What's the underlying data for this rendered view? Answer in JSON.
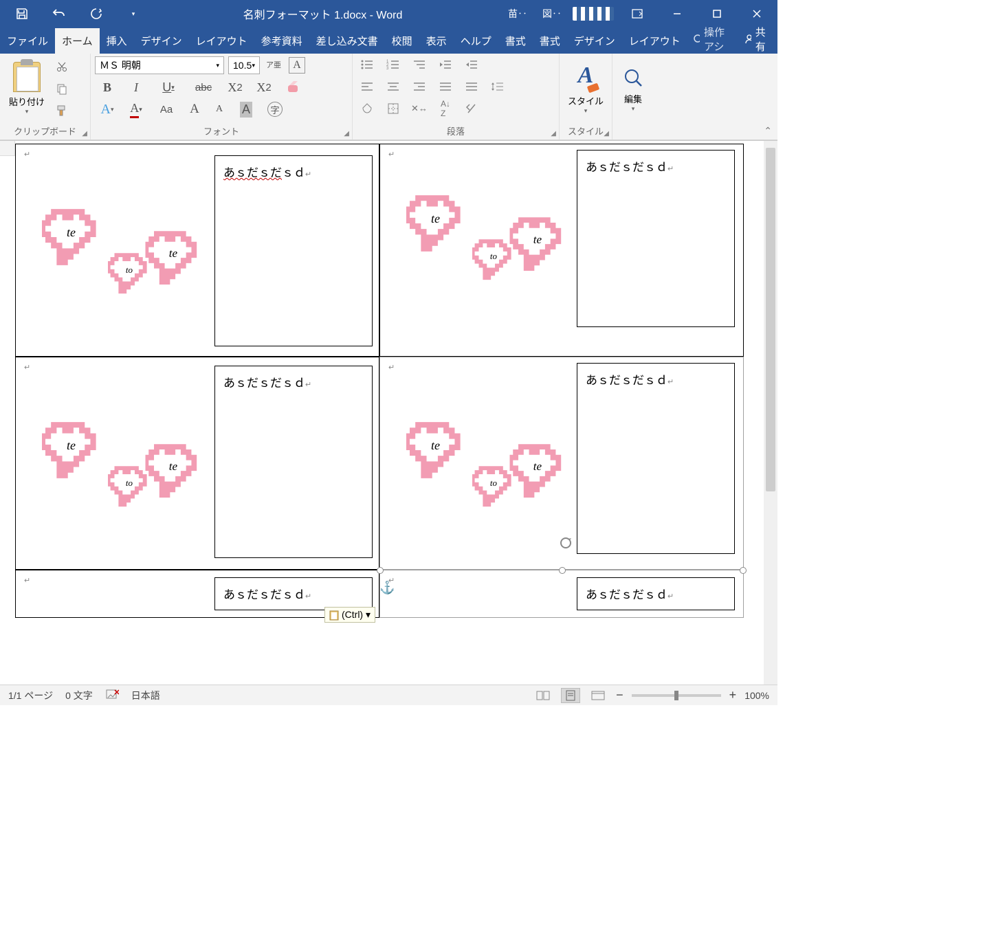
{
  "title": "名刺フォーマット 1.docx  -  Word",
  "thumbs": [
    "苗‥",
    "図‥"
  ],
  "tabs": [
    "ファイル",
    "ホーム",
    "挿入",
    "デザイン",
    "レイアウト",
    "参考資料",
    "差し込み文書",
    "校閲",
    "表示",
    "ヘルプ",
    "書式",
    "書式",
    "デザイン",
    "レイアウト"
  ],
  "active_tab": 1,
  "tell_me": "操作アシ",
  "share": "共有",
  "clipboard": {
    "paste": "貼り付け",
    "label": "クリップボード"
  },
  "font": {
    "name": "ＭＳ 明朝",
    "size": "10.5",
    "label": "フォント",
    "bold": "B",
    "italic": "I",
    "underline": "U",
    "strike": "abc",
    "sub": "X₂",
    "sup": "X²",
    "plainA": "A",
    "colorA": "A",
    "caseAa": "Aa",
    "bigA": "A",
    "smallA": "A",
    "hiA": "A",
    "circleChar": "字"
  },
  "paragraph": {
    "label": "段落"
  },
  "styles": {
    "label": "スタイル",
    "text": "スタイル"
  },
  "editing": {
    "label": "",
    "text": "編集"
  },
  "card": {
    "text": "あｓだｓだｓｄ",
    "hearts": {
      "h1": "te",
      "h2": "te",
      "h3": "to"
    }
  },
  "paste_options": "(Ctrl) ▾",
  "status": {
    "page": "1/1 ページ",
    "words": "0 文字",
    "lang": "日本語",
    "zoom": "100%"
  }
}
